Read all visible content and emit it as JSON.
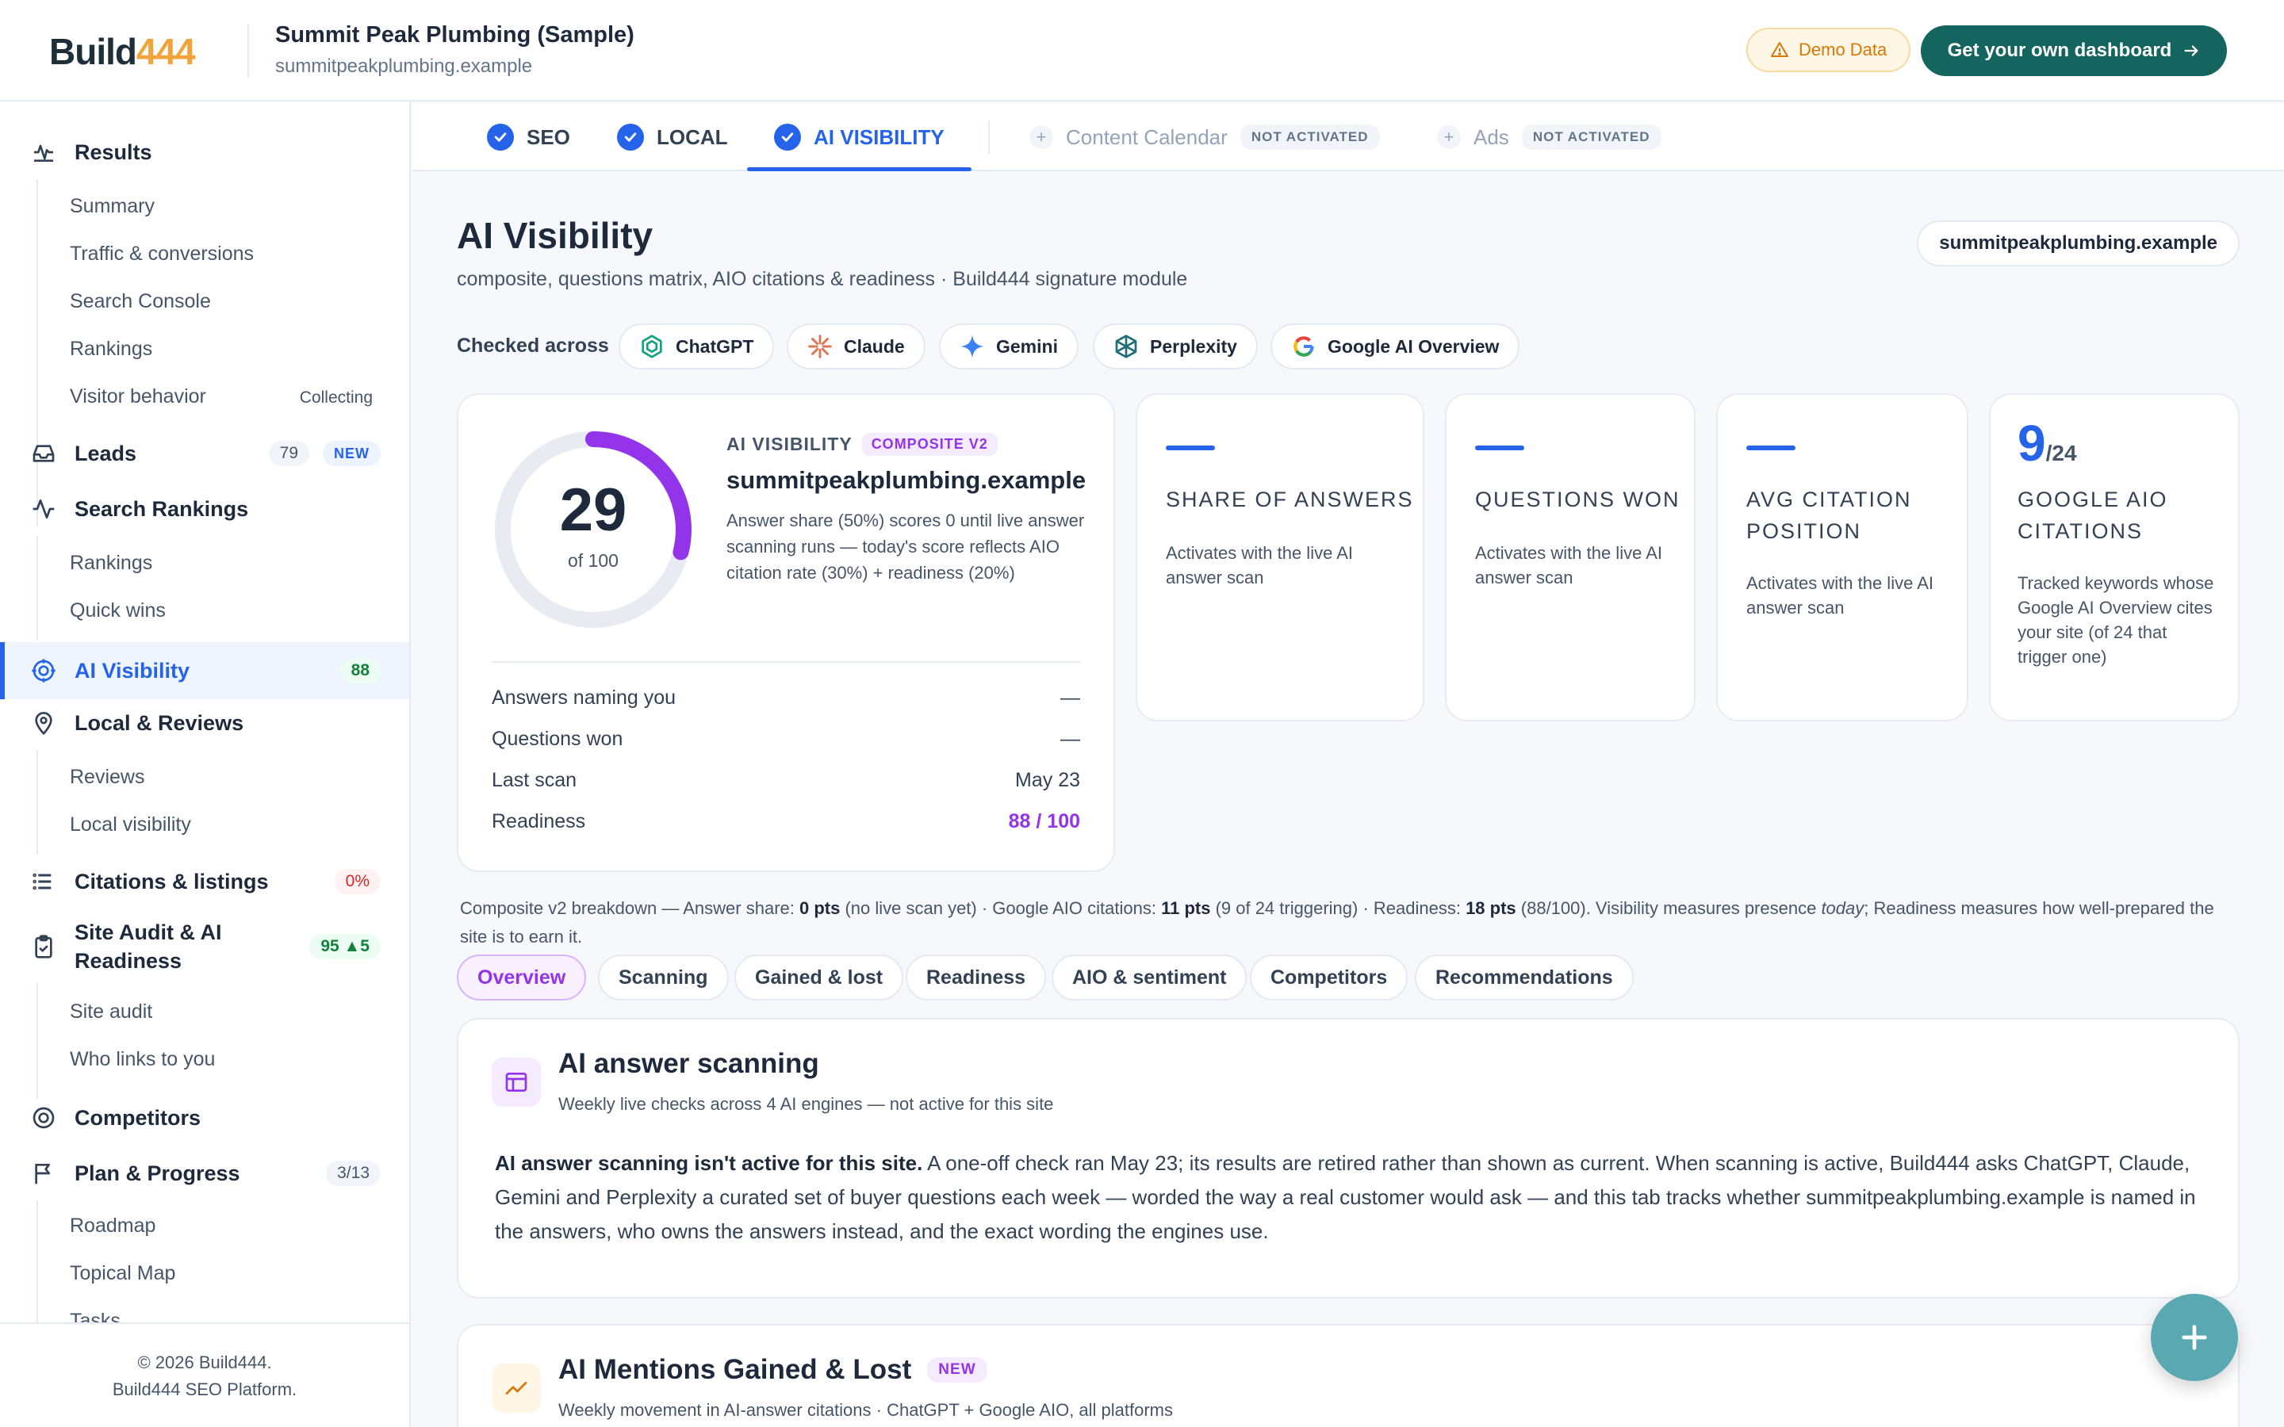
{
  "header": {
    "logo_main": "Build",
    "logo_accent": "444",
    "site_title": "Summit Peak Plumbing (Sample)",
    "site_url": "summitpeakplumbing.example",
    "demo_label": "Demo Data",
    "cta_label": "Get your own dashboard",
    "accent_color": "#14645f"
  },
  "sidebar": {
    "results": {
      "label": "Results",
      "items": [
        "Summary",
        "Traffic & conversions",
        "Search Console",
        "Rankings",
        "Visitor behavior"
      ],
      "visitor_note": "Collecting"
    },
    "leads": {
      "label": "Leads",
      "count": "79",
      "new": "NEW"
    },
    "search_rankings": {
      "label": "Search Rankings",
      "items": [
        "Rankings",
        "Quick wins"
      ]
    },
    "ai_visibility": {
      "label": "AI Visibility",
      "score": "88"
    },
    "local_reviews": {
      "label": "Local & Reviews",
      "items": [
        "Reviews",
        "Local visibility"
      ]
    },
    "citations": {
      "label": "Citations & listings",
      "badge": "0%"
    },
    "site_audit": {
      "label": "Site Audit & AI Readiness",
      "badge": "95 ▲5",
      "items": [
        "Site audit",
        "Who links to you"
      ]
    },
    "competitors": {
      "label": "Competitors"
    },
    "plan": {
      "label": "Plan & Progress",
      "badge": "3/13",
      "items": [
        "Roadmap",
        "Topical Map",
        "Tasks"
      ]
    },
    "footer_line1": "© 2026 Build444.",
    "footer_line2": "Build444 SEO Platform."
  },
  "tabs": {
    "seo": "SEO",
    "local": "LOCAL",
    "ai": "AI VISIBILITY",
    "content_calendar": "Content Calendar",
    "ads": "Ads",
    "not_activated": "NOT ACTIVATED"
  },
  "main": {
    "title": "AI Visibility",
    "subtitle": "composite, questions matrix, AIO citations & readiness · Build444 signature module",
    "domain_pill": "summitpeakplumbing.example",
    "checked_across": "Checked across",
    "engines": [
      "ChatGPT",
      "Claude",
      "Gemini",
      "Perplexity",
      "Google AI Overview"
    ]
  },
  "score_card": {
    "score": "29",
    "score_value": 29,
    "of_label": "of 100",
    "label": "AI VISIBILITY",
    "badge": "COMPOSITE V2",
    "domain": "summitpeakplumbing.example",
    "description": "Answer share (50%) scores 0 until live answer scanning runs — today's score reflects AIO citation rate (30%) + readiness (20%)",
    "rows": [
      {
        "key": "Answers naming you",
        "value": "—"
      },
      {
        "key": "Questions won",
        "value": "—"
      },
      {
        "key": "Last scan",
        "value": "May 23"
      },
      {
        "key": "Readiness",
        "value": "88 / 100"
      }
    ]
  },
  "metrics": {
    "share": {
      "title": "SHARE OF ANSWERS",
      "desc": "Activates with the live AI answer scan"
    },
    "questions": {
      "title": "QUESTIONS WON",
      "desc": "Activates with the live AI answer scan"
    },
    "avg": {
      "title": "AVG CITATION POSITION",
      "desc": "Activates with the live AI answer scan"
    },
    "aio": {
      "value": "9",
      "denominator": "/24",
      "title": "GOOGLE AIO CITATIONS",
      "desc": "Tracked keywords whose Google AI Overview cites your site (of 24 that trigger one)"
    }
  },
  "breakdown": {
    "intro": "Composite v2 breakdown — Answer share: ",
    "answer_pts": "0 pts",
    "answer_note": " (no live scan yet) · Google AIO citations: ",
    "aio_pts": "11 pts",
    "aio_note": " (9 of 24 triggering) · Readiness: ",
    "readiness_pts": "18 pts",
    "readiness_note": " (88/100). Visibility measures presence ",
    "today": "today",
    "tail": "; Readiness measures how well-prepared the site is to earn it."
  },
  "subtabs": [
    "Overview",
    "Scanning",
    "Gained & lost",
    "Readiness",
    "AIO & sentiment",
    "Competitors",
    "Recommendations"
  ],
  "scanning": {
    "title": "AI answer scanning",
    "subtitle": "Weekly live checks across 4 AI engines — not active for this site",
    "lead": "AI answer scanning isn't active for this site.",
    "body": " A one-off check ran May 23; its results are retired rather than shown as current. When scanning is active, Build444 asks ChatGPT, Claude, Gemini and Perplexity a curated set of buyer questions each week — worded the way a real customer would ask — and this tab tracks whether summitpeakplumbing.example is named in the answers, who owns the answers instead, and the exact wording the engines use."
  },
  "mentions": {
    "title": "AI Mentions Gained & Lost",
    "badge": "NEW",
    "subtitle": "Weekly movement in AI-answer citations · ChatGPT + Google AIO, all platforms"
  }
}
